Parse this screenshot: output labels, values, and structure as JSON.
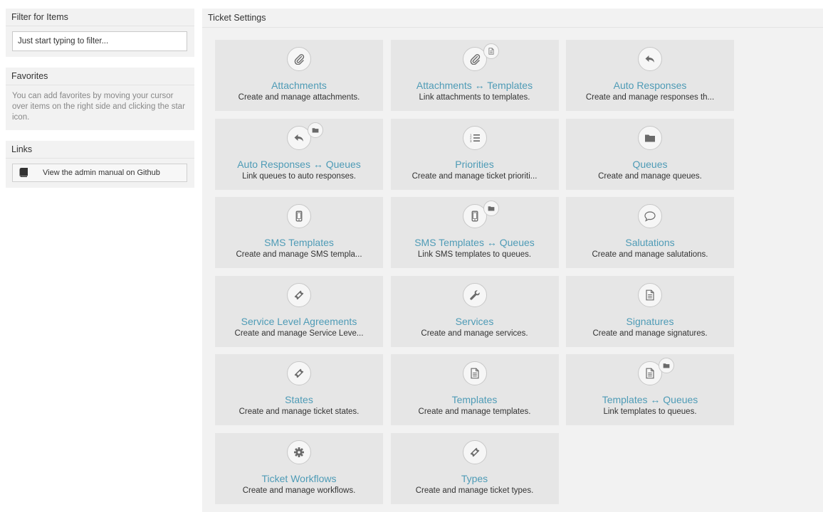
{
  "sidebar": {
    "filter": {
      "title": "Filter for Items",
      "placeholder": "Just start typing to filter..."
    },
    "favorites": {
      "title": "Favorites",
      "text": "You can add favorites by moving your cursor over items on the right side and clicking the star icon."
    },
    "links": {
      "title": "Links",
      "manual_label": "View the admin manual on Github"
    }
  },
  "main": {
    "title": "Ticket Settings",
    "tiles": [
      {
        "title": "Attachments",
        "desc": "Create and manage attachments.",
        "icon": "paperclip-icon"
      },
      {
        "title": "Attachments ↔ Templates",
        "desc": "Link attachments to templates.",
        "icon": "paperclip-icon",
        "badge": "document-icon"
      },
      {
        "title": "Auto Responses",
        "desc": "Create and manage responses th...",
        "icon": "reply-icon"
      },
      {
        "title": "Auto Responses ↔ Queues",
        "desc": "Link queues to auto responses.",
        "icon": "reply-icon",
        "badge": "folder-icon"
      },
      {
        "title": "Priorities",
        "desc": "Create and manage ticket prioriti...",
        "icon": "ordered-list-icon"
      },
      {
        "title": "Queues",
        "desc": "Create and manage queues.",
        "icon": "folder-icon"
      },
      {
        "title": "SMS Templates",
        "desc": "Create and manage SMS templa...",
        "icon": "mobile-icon"
      },
      {
        "title": "SMS Templates ↔ Queues",
        "desc": "Link SMS templates to queues.",
        "icon": "mobile-icon",
        "badge": "folder-icon"
      },
      {
        "title": "Salutations",
        "desc": "Create and manage salutations.",
        "icon": "speech-bubble-icon"
      },
      {
        "title": "Service Level Agreements",
        "desc": "Create and manage Service Leve...",
        "icon": "ticket-icon"
      },
      {
        "title": "Services",
        "desc": "Create and manage services.",
        "icon": "wrench-icon"
      },
      {
        "title": "Signatures",
        "desc": "Create and manage signatures.",
        "icon": "document-icon"
      },
      {
        "title": "States",
        "desc": "Create and manage ticket states.",
        "icon": "ticket-icon"
      },
      {
        "title": "Templates",
        "desc": "Create and manage templates.",
        "icon": "document-icon"
      },
      {
        "title": "Templates ↔ Queues",
        "desc": "Link templates to queues.",
        "icon": "document-icon",
        "badge": "folder-icon"
      },
      {
        "title": "Ticket Workflows",
        "desc": "Create and manage workflows.",
        "icon": "gear-icon"
      },
      {
        "title": "Types",
        "desc": "Create and manage ticket types.",
        "icon": "ticket-icon"
      }
    ]
  },
  "colors": {
    "link": "#4e9bb6",
    "tile_bg": "#e6e6e6",
    "panel_bg": "#f2f2f2"
  }
}
